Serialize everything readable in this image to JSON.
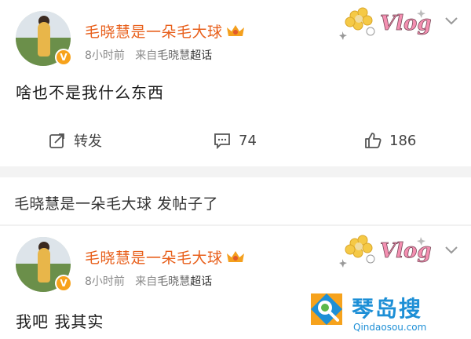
{
  "posts": [
    {
      "username": "毛晓慧是一朵毛大球",
      "time": "8小时前",
      "from_prefix": "来自",
      "from_name": "毛晓慧",
      "from_suffix": "超话",
      "content": "啥也不是我什么东西",
      "actions": {
        "repost_label": "转发",
        "comments": "74",
        "likes": "186"
      },
      "badge_text": "Vlog"
    },
    {
      "username": "毛晓慧是一朵毛大球",
      "time": "8小时前",
      "from_prefix": "来自",
      "from_name": "毛晓慧",
      "from_suffix": "超话",
      "content": "我吧 我其实",
      "badge_text": "Vlog"
    }
  ],
  "notice": "毛晓慧是一朵毛大球 发帖子了",
  "watermark": {
    "title": "琴岛搜",
    "url": "Qindaosou.com"
  },
  "colors": {
    "username": "#e8601c",
    "meta": "#8a8a8a",
    "divider": "#f3f3f3",
    "watermark": "#1d8fd6"
  },
  "icons": [
    "repost-icon",
    "comment-icon",
    "like-icon",
    "chevron-down-icon",
    "crown-icon",
    "verified-icon"
  ]
}
